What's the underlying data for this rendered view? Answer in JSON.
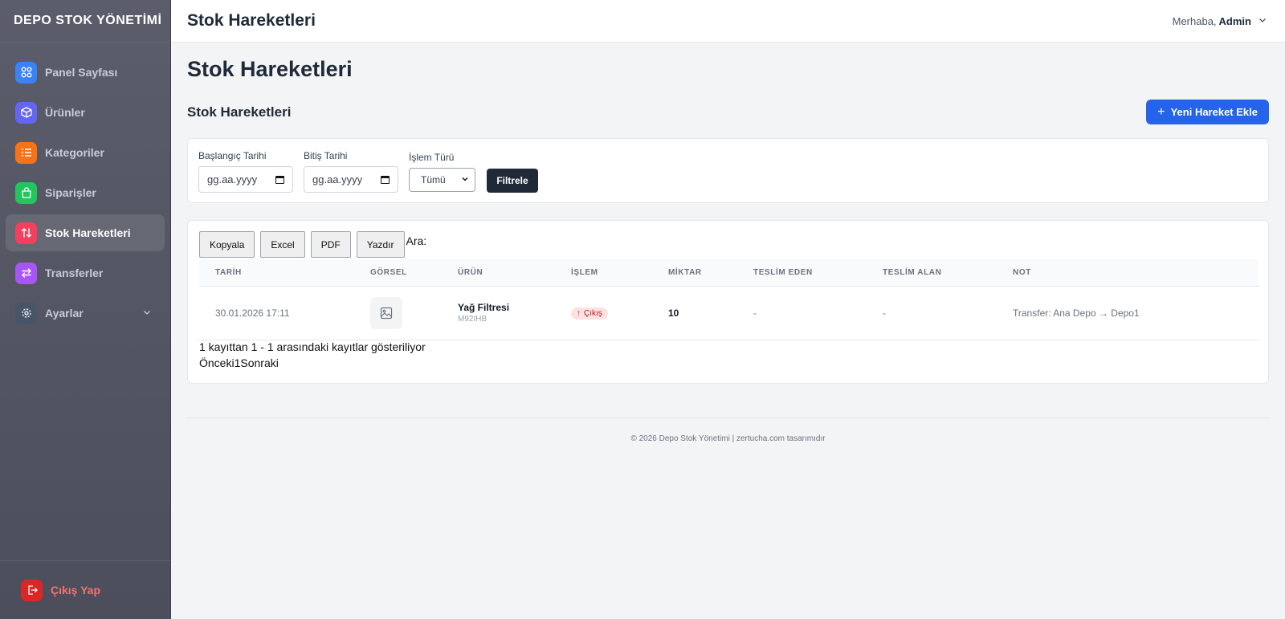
{
  "sidebar": {
    "brand": "DEPO STOK YÖNETİMİ",
    "items": [
      {
        "label": "Panel Sayfası",
        "icon": "grid-icon"
      },
      {
        "label": "Ürünler",
        "icon": "box-icon"
      },
      {
        "label": "Kategoriler",
        "icon": "list-icon"
      },
      {
        "label": "Siparişler",
        "icon": "shopping-bag-icon"
      },
      {
        "label": "Stok Hareketleri",
        "icon": "swap-vertical-icon",
        "active": true
      },
      {
        "label": "Transferler",
        "icon": "swap-horizontal-icon"
      },
      {
        "label": "Ayarlar",
        "icon": "gear-icon"
      }
    ],
    "logout": "Çıkış Yap"
  },
  "topbar": {
    "title": "Stok Hareketleri",
    "greeting": "Merhaba,",
    "user": "Admin"
  },
  "main": {
    "page_title": "Stok Hareketleri",
    "section_title": "Stok Hareketleri",
    "add_button": "Yeni Hareket Ekle",
    "filters": {
      "start_label": "Başlangıç Tarihi",
      "start_value": "gg.aa.yyyy",
      "end_label": "Bitiş Tarihi",
      "end_value": "gg.aa.yyyy",
      "type_label": "İşlem Türü",
      "type_value": "Tümü",
      "filter_button": "Filtrele"
    },
    "tools": {
      "copy": "Kopyala",
      "excel": "Excel",
      "pdf": "PDF",
      "print": "Yazdır",
      "search_label": "Ara:"
    },
    "table": {
      "columns": [
        "TARİH",
        "GÖRSEL",
        "ÜRÜN",
        "İŞLEM",
        "MİKTAR",
        "TESLİM EDEN",
        "TESLİM ALAN",
        "NOT"
      ],
      "rows": [
        {
          "date": "30.01.2026 17:11",
          "product_name": "Yağ Filtresi",
          "product_code": "M92IHB",
          "operation": "Çıkış",
          "quantity": "10",
          "delivered_by": "-",
          "received_by": "-",
          "note": "Transfer: Ana Depo → Depo1"
        }
      ]
    },
    "info": "1 kayıttan 1 - 1 arasındaki kayıtlar gösteriliyor",
    "pager": {
      "prev": "Önceki",
      "page": "1",
      "next": "Sonraki"
    }
  },
  "footer": "© 2026 Depo Stok Yönetimi | zertucha.com tasarımıdır",
  "colors": {
    "accent": "#2563eb",
    "sidebar_bg": "#54566a",
    "danger": "#dc2626",
    "dark_button": "#1f2937"
  }
}
